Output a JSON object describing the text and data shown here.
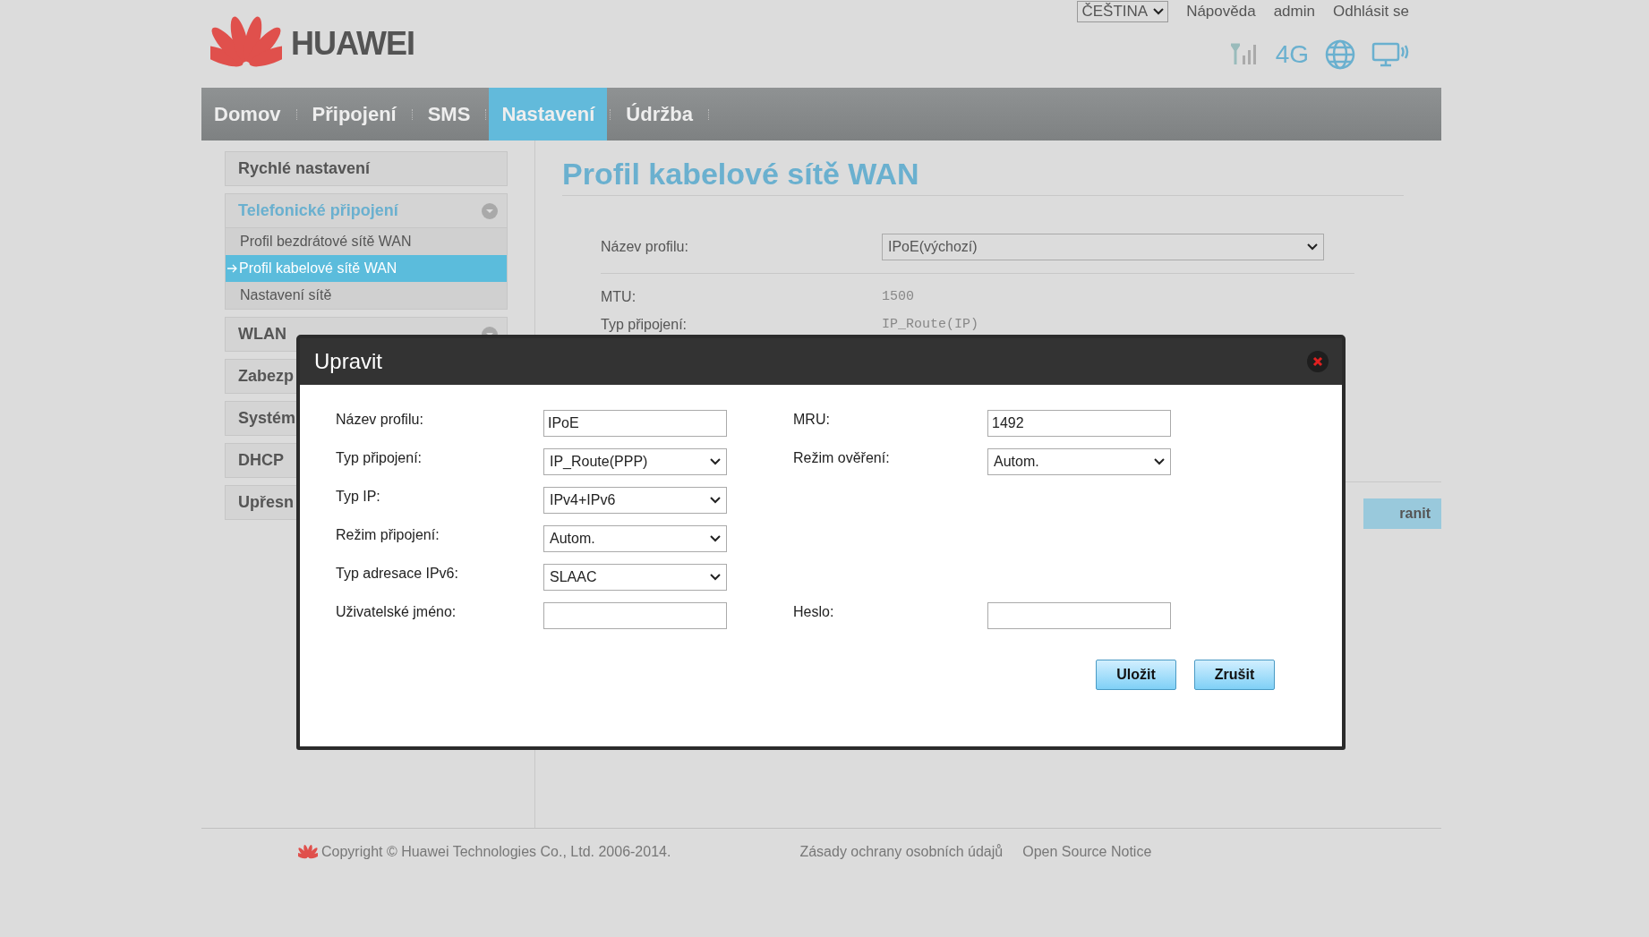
{
  "header": {
    "logo_text": "HUAWEI",
    "language": "ČEŠTINA",
    "links": [
      "Nápověda",
      "admin",
      "Odhlásit se"
    ],
    "network": "4G"
  },
  "nav": [
    {
      "label": "Domov",
      "selected": false
    },
    {
      "label": "Připojení",
      "selected": false
    },
    {
      "label": "SMS",
      "selected": false
    },
    {
      "label": "Nastavení",
      "selected": true
    },
    {
      "label": "Údržba",
      "selected": false
    }
  ],
  "sidebar": [
    {
      "label": "Rychlé nastavení",
      "kind": "link",
      "selected": false
    },
    {
      "label": "Telefonické připojení",
      "kind": "expandable",
      "selected": true,
      "children": [
        {
          "label": "Profil bezdrátové sítě WAN",
          "selected": false
        },
        {
          "label": "Profil kabelové sítě WAN",
          "selected": true
        },
        {
          "label": "Nastavení sítě",
          "selected": false
        }
      ]
    },
    {
      "label": "WLAN",
      "kind": "expandable",
      "selected": false
    },
    {
      "label": "Zabezp",
      "kind": "link",
      "selected": false
    },
    {
      "label": "Systém",
      "kind": "link",
      "selected": false
    },
    {
      "label": "DHCP",
      "kind": "link",
      "selected": false
    },
    {
      "label": "Upřesn",
      "kind": "link",
      "selected": false
    }
  ],
  "content": {
    "title": "Profil kabelové sítě WAN",
    "profile": {
      "label": "Název profilu:",
      "value": "IPoE(výchozí)"
    },
    "rows": [
      {
        "label": "MTU:",
        "value": "1500"
      },
      {
        "label": "Typ připojení:",
        "value": "IP_Route(IP)"
      }
    ],
    "button": "ranit"
  },
  "dialog": {
    "title": "Upravit",
    "rows": [
      {
        "left": {
          "label": "Název profilu:",
          "kind": "text",
          "value": "IPoE"
        },
        "right": {
          "label": "MRU:",
          "kind": "text",
          "value": "1492"
        }
      },
      {
        "left": {
          "label": "Typ připojení:",
          "kind": "select",
          "value": "IP_Route(PPP)"
        },
        "right": {
          "label": "Režim ověření:",
          "kind": "select",
          "value": "Autom."
        }
      },
      {
        "left": {
          "label": "Typ IP:",
          "kind": "select",
          "value": "IPv4+IPv6"
        }
      },
      {
        "left": {
          "label": "Režim připojení:",
          "kind": "select",
          "value": "Autom."
        }
      },
      {
        "left": {
          "label": "Typ adresace IPv6:",
          "kind": "select",
          "value": "SLAAC"
        }
      },
      {
        "left": {
          "label": "Uživatelské jméno:",
          "kind": "text"
        },
        "right": {
          "label": "Heslo:",
          "kind": "password"
        }
      }
    ],
    "buttons": [
      "Uložit",
      "Zrušit"
    ]
  },
  "footer": {
    "copyright": "Copyright © Huawei Technologies Co., Ltd. 2006-2014.",
    "links": [
      "Zásady ochrany osobních údajů",
      "Open Source Notice"
    ]
  }
}
